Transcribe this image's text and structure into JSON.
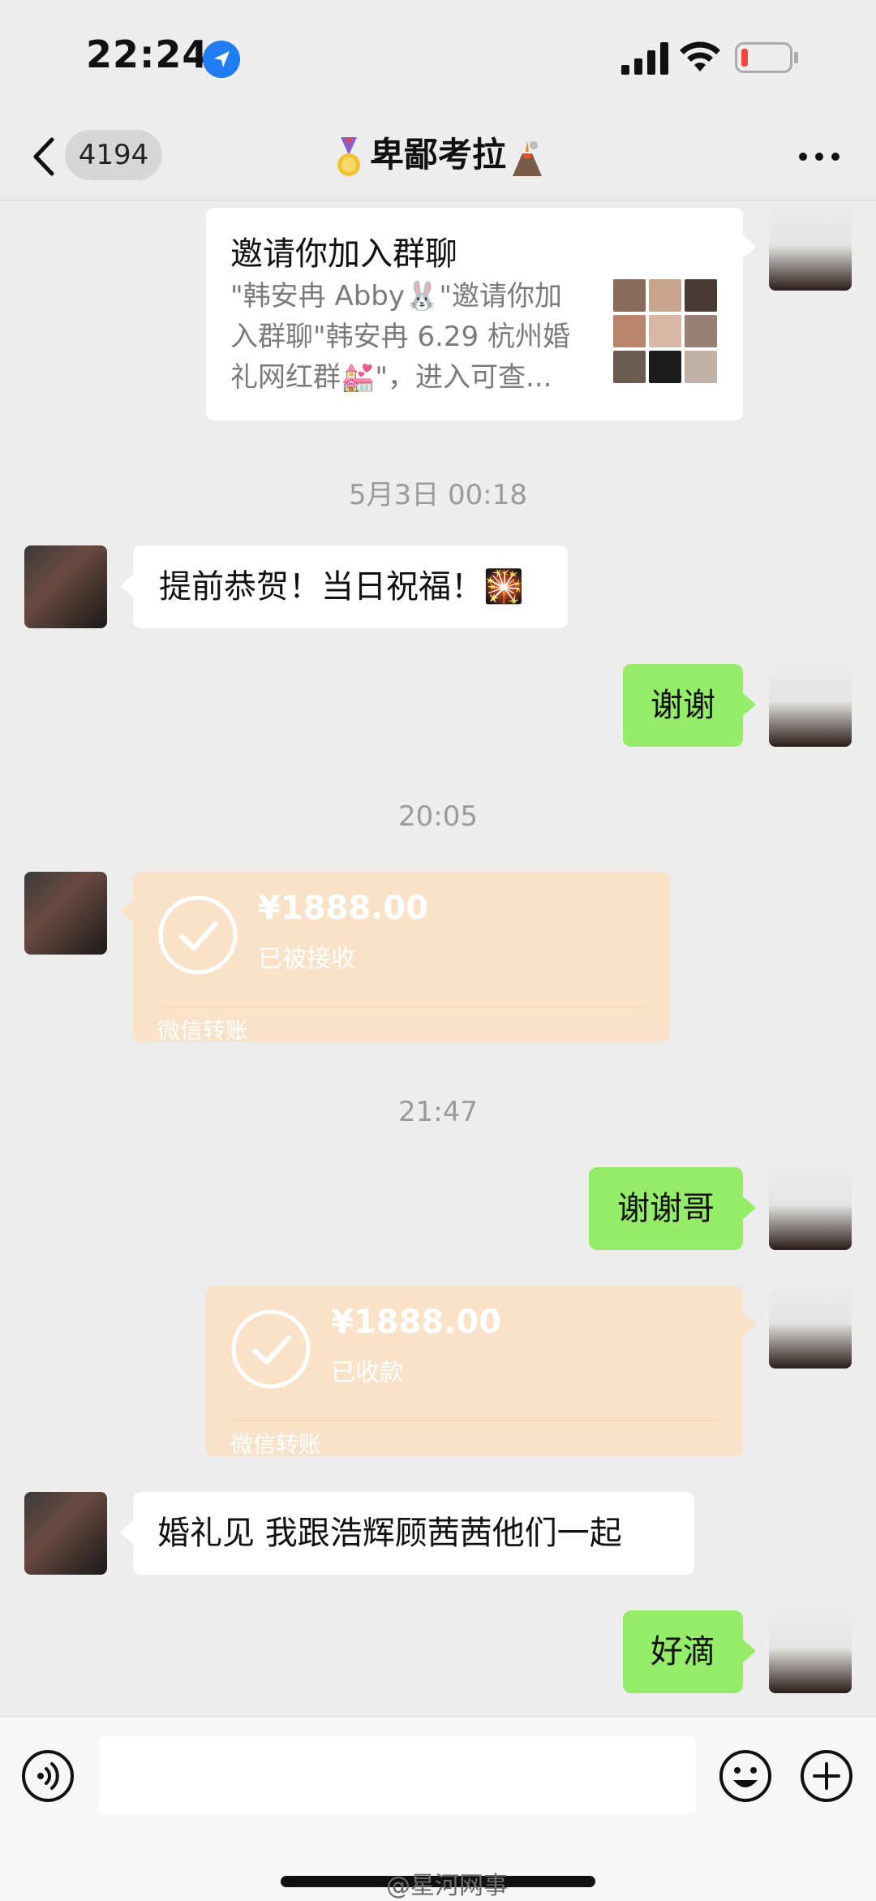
{
  "status_bar": {
    "time": "22:24"
  },
  "nav": {
    "unread_count": "4194",
    "title": "卑鄙考拉"
  },
  "invite_card": {
    "title": "邀请你加入群聊",
    "description": "\"韩安冉 Abby🐰\"邀请你加入群聊\"韩安冉 6.29 杭州婚礼网红群💒\"，进入可查..."
  },
  "timestamps": [
    "5月3日 00:18",
    "20:05",
    "21:47"
  ],
  "messages": {
    "congrats": "提前恭贺！当日祝福！🎇",
    "thanks": "谢谢",
    "thanks_bro": "谢谢哥",
    "see_you": "婚礼见 我跟浩辉顾茜茜他们一起",
    "ok": "好滴"
  },
  "transfers": [
    {
      "amount": "¥1888.00",
      "state": "已被接收",
      "brand": "微信转账"
    },
    {
      "amount": "¥1888.00",
      "state": "已收款",
      "brand": "微信转账"
    }
  ],
  "input": {
    "placeholder": ""
  },
  "watermark": "@星河网事",
  "colors": {
    "green_bubble": "#95ec69",
    "transfer_bg": "#f9e2c8",
    "background": "#ededed"
  }
}
